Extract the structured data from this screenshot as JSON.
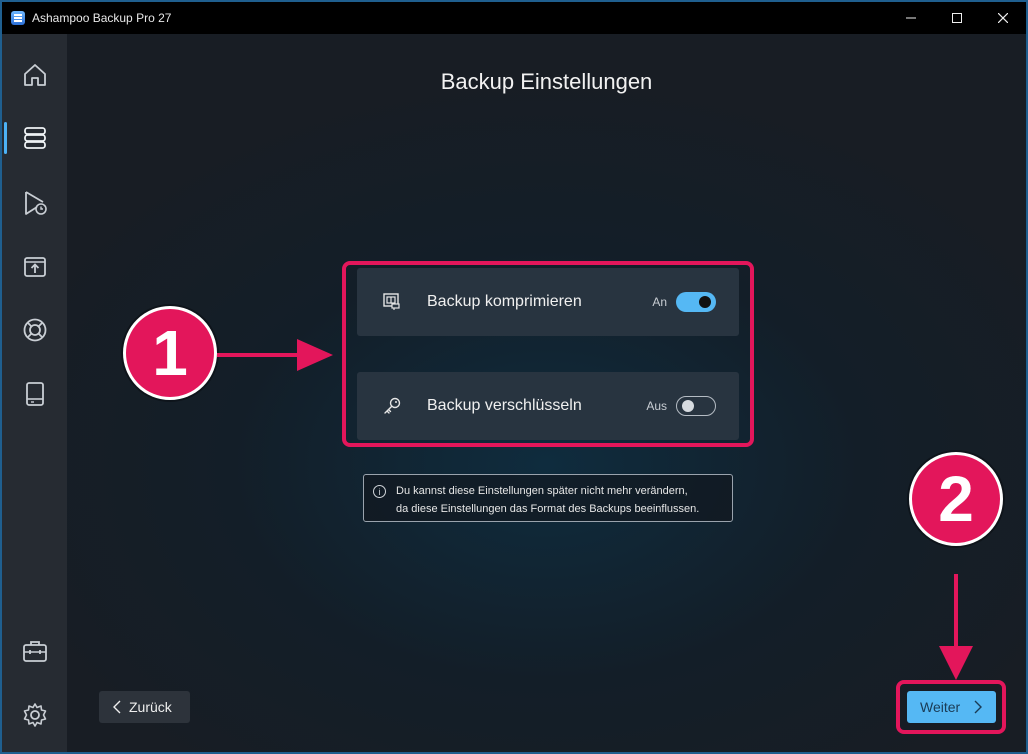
{
  "window": {
    "title": "Ashampoo Backup Pro 27"
  },
  "controls": {
    "minimize": "—",
    "maximize": "☐",
    "close": "✕"
  },
  "sidebar": {
    "items": [
      {
        "name": "home-icon",
        "active": false
      },
      {
        "name": "backups-icon",
        "active": true
      },
      {
        "name": "restore-icon",
        "active": false
      },
      {
        "name": "upload-icon",
        "active": false
      },
      {
        "name": "help-icon",
        "active": false
      },
      {
        "name": "drive-icon",
        "active": false
      },
      {
        "name": "toolbox-icon",
        "active": false
      },
      {
        "name": "settings-icon",
        "active": false
      }
    ]
  },
  "main": {
    "title": "Backup Einstellungen",
    "options": [
      {
        "label": "Backup komprimieren",
        "state_label": "An",
        "enabled": true,
        "icon": "compress-icon"
      },
      {
        "label": "Backup verschlüsseln",
        "state_label": "Aus",
        "enabled": false,
        "icon": "key-icon"
      }
    ],
    "info": {
      "line1": "Du kannst diese Einstellungen später nicht mehr verändern,",
      "line2": "da diese Einstellungen das Format des Backups beeinflussen."
    },
    "back_label": "Zurück",
    "next_label": "Weiter"
  },
  "annotations": {
    "badge1": "1",
    "badge2": "2",
    "color": "#e3165b"
  }
}
